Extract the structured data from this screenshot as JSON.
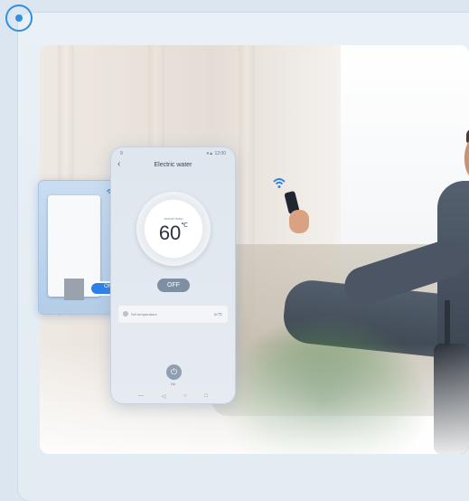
{
  "colors": {
    "accent": "#2d80e8",
    "frame": "#e6edf4",
    "phone_bg": "#e2e8ef",
    "off_button": "#7f8fa3"
  },
  "icons": {
    "logo": "circle-logo-icon",
    "wifi": "wifi-icon",
    "power": "power-icon",
    "back": "back-chevron-icon"
  },
  "heater": {
    "toggle_label": "ON"
  },
  "phone": {
    "status_left": "9",
    "status_right": "▾▲ 12:00",
    "back_glyph": "‹",
    "title": "Electric water",
    "dial_label": "Actual temp",
    "temperature": "60",
    "unit": "℃",
    "off_label": "OFF",
    "set_label": "Set temperature",
    "set_value": "60℃",
    "power_glyph": "⏻",
    "power_label": "On",
    "nav": [
      "—",
      "◁",
      "○",
      "□"
    ]
  }
}
